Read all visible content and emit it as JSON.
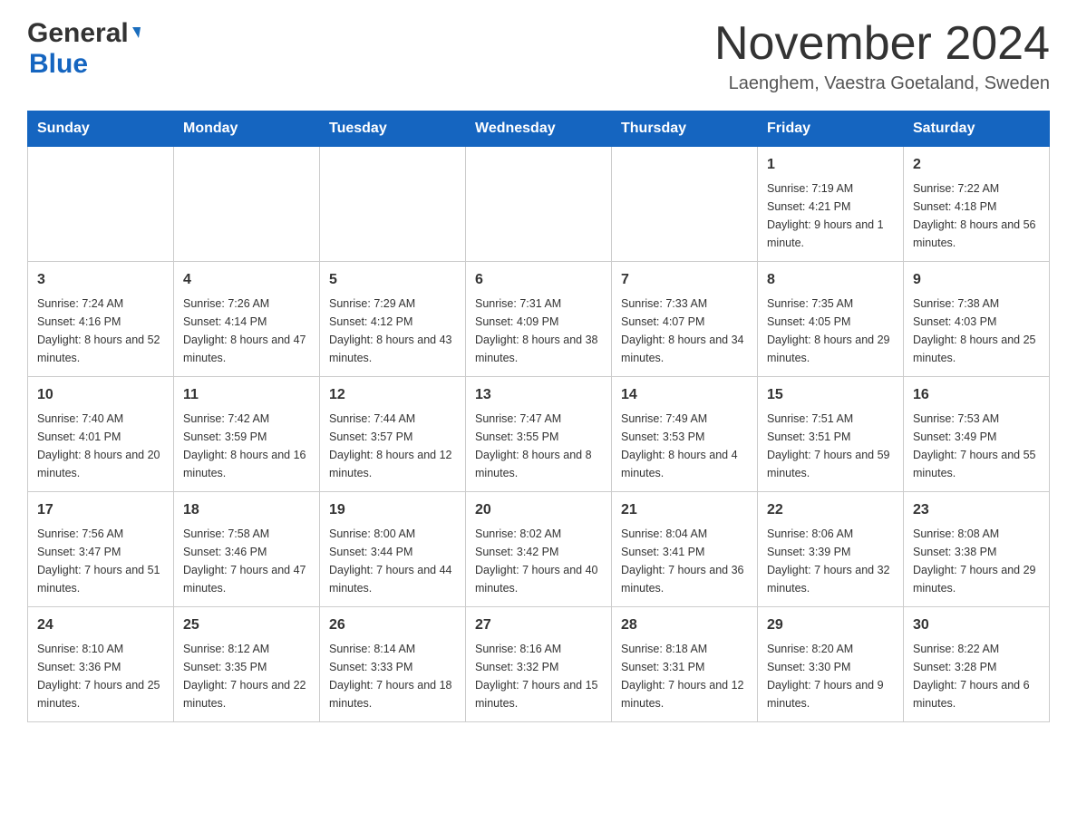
{
  "logo": {
    "text_general": "General",
    "text_blue": "Blue"
  },
  "title": {
    "month_year": "November 2024",
    "location": "Laenghem, Vaestra Goetaland, Sweden"
  },
  "headers": [
    "Sunday",
    "Monday",
    "Tuesday",
    "Wednesday",
    "Thursday",
    "Friday",
    "Saturday"
  ],
  "weeks": [
    [
      {
        "day": "",
        "info": ""
      },
      {
        "day": "",
        "info": ""
      },
      {
        "day": "",
        "info": ""
      },
      {
        "day": "",
        "info": ""
      },
      {
        "day": "",
        "info": ""
      },
      {
        "day": "1",
        "info": "Sunrise: 7:19 AM\nSunset: 4:21 PM\nDaylight: 9 hours and 1 minute."
      },
      {
        "day": "2",
        "info": "Sunrise: 7:22 AM\nSunset: 4:18 PM\nDaylight: 8 hours and 56 minutes."
      }
    ],
    [
      {
        "day": "3",
        "info": "Sunrise: 7:24 AM\nSunset: 4:16 PM\nDaylight: 8 hours and 52 minutes."
      },
      {
        "day": "4",
        "info": "Sunrise: 7:26 AM\nSunset: 4:14 PM\nDaylight: 8 hours and 47 minutes."
      },
      {
        "day": "5",
        "info": "Sunrise: 7:29 AM\nSunset: 4:12 PM\nDaylight: 8 hours and 43 minutes."
      },
      {
        "day": "6",
        "info": "Sunrise: 7:31 AM\nSunset: 4:09 PM\nDaylight: 8 hours and 38 minutes."
      },
      {
        "day": "7",
        "info": "Sunrise: 7:33 AM\nSunset: 4:07 PM\nDaylight: 8 hours and 34 minutes."
      },
      {
        "day": "8",
        "info": "Sunrise: 7:35 AM\nSunset: 4:05 PM\nDaylight: 8 hours and 29 minutes."
      },
      {
        "day": "9",
        "info": "Sunrise: 7:38 AM\nSunset: 4:03 PM\nDaylight: 8 hours and 25 minutes."
      }
    ],
    [
      {
        "day": "10",
        "info": "Sunrise: 7:40 AM\nSunset: 4:01 PM\nDaylight: 8 hours and 20 minutes."
      },
      {
        "day": "11",
        "info": "Sunrise: 7:42 AM\nSunset: 3:59 PM\nDaylight: 8 hours and 16 minutes."
      },
      {
        "day": "12",
        "info": "Sunrise: 7:44 AM\nSunset: 3:57 PM\nDaylight: 8 hours and 12 minutes."
      },
      {
        "day": "13",
        "info": "Sunrise: 7:47 AM\nSunset: 3:55 PM\nDaylight: 8 hours and 8 minutes."
      },
      {
        "day": "14",
        "info": "Sunrise: 7:49 AM\nSunset: 3:53 PM\nDaylight: 8 hours and 4 minutes."
      },
      {
        "day": "15",
        "info": "Sunrise: 7:51 AM\nSunset: 3:51 PM\nDaylight: 7 hours and 59 minutes."
      },
      {
        "day": "16",
        "info": "Sunrise: 7:53 AM\nSunset: 3:49 PM\nDaylight: 7 hours and 55 minutes."
      }
    ],
    [
      {
        "day": "17",
        "info": "Sunrise: 7:56 AM\nSunset: 3:47 PM\nDaylight: 7 hours and 51 minutes."
      },
      {
        "day": "18",
        "info": "Sunrise: 7:58 AM\nSunset: 3:46 PM\nDaylight: 7 hours and 47 minutes."
      },
      {
        "day": "19",
        "info": "Sunrise: 8:00 AM\nSunset: 3:44 PM\nDaylight: 7 hours and 44 minutes."
      },
      {
        "day": "20",
        "info": "Sunrise: 8:02 AM\nSunset: 3:42 PM\nDaylight: 7 hours and 40 minutes."
      },
      {
        "day": "21",
        "info": "Sunrise: 8:04 AM\nSunset: 3:41 PM\nDaylight: 7 hours and 36 minutes."
      },
      {
        "day": "22",
        "info": "Sunrise: 8:06 AM\nSunset: 3:39 PM\nDaylight: 7 hours and 32 minutes."
      },
      {
        "day": "23",
        "info": "Sunrise: 8:08 AM\nSunset: 3:38 PM\nDaylight: 7 hours and 29 minutes."
      }
    ],
    [
      {
        "day": "24",
        "info": "Sunrise: 8:10 AM\nSunset: 3:36 PM\nDaylight: 7 hours and 25 minutes."
      },
      {
        "day": "25",
        "info": "Sunrise: 8:12 AM\nSunset: 3:35 PM\nDaylight: 7 hours and 22 minutes."
      },
      {
        "day": "26",
        "info": "Sunrise: 8:14 AM\nSunset: 3:33 PM\nDaylight: 7 hours and 18 minutes."
      },
      {
        "day": "27",
        "info": "Sunrise: 8:16 AM\nSunset: 3:32 PM\nDaylight: 7 hours and 15 minutes."
      },
      {
        "day": "28",
        "info": "Sunrise: 8:18 AM\nSunset: 3:31 PM\nDaylight: 7 hours and 12 minutes."
      },
      {
        "day": "29",
        "info": "Sunrise: 8:20 AM\nSunset: 3:30 PM\nDaylight: 7 hours and 9 minutes."
      },
      {
        "day": "30",
        "info": "Sunrise: 8:22 AM\nSunset: 3:28 PM\nDaylight: 7 hours and 6 minutes."
      }
    ]
  ]
}
